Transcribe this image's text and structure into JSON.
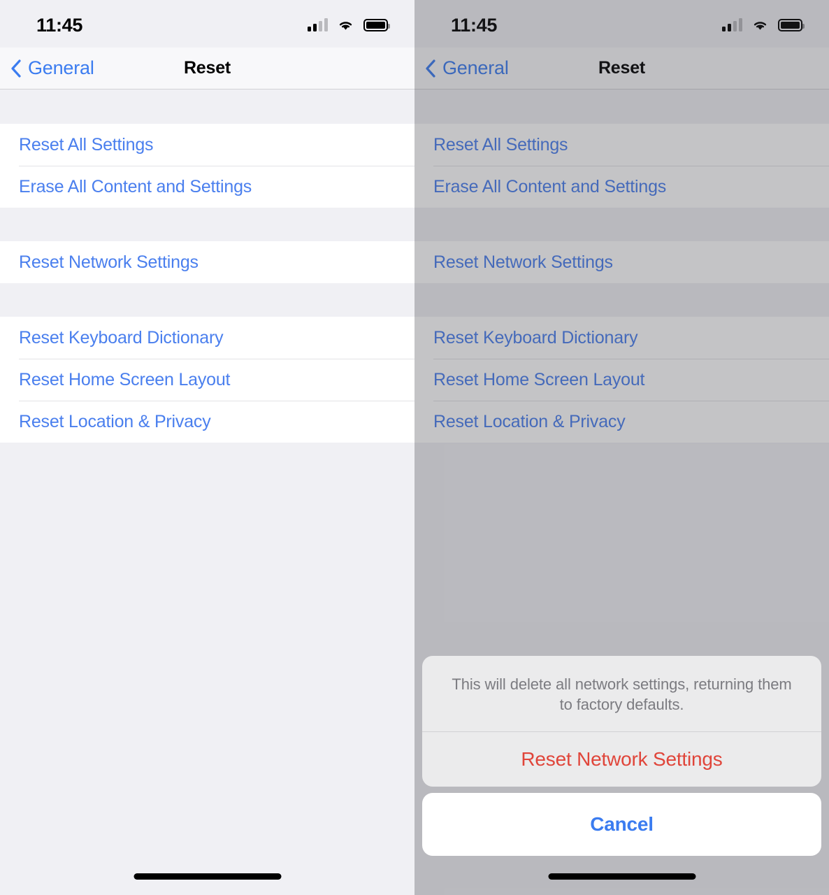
{
  "screens": [
    {
      "id": "reset-screen",
      "dimmed": false,
      "statusbar": {
        "time": "11:45",
        "cellular_icon": "cellular-bars-icon",
        "wifi_icon": "wifi-icon",
        "battery_icon": "battery-icon"
      },
      "navbar": {
        "back_icon": "chevron-left-icon",
        "back_label": "General",
        "title": "Reset"
      },
      "groups": [
        {
          "rows": [
            {
              "label": "Reset All Settings"
            },
            {
              "label": "Erase All Content and Settings"
            }
          ]
        },
        {
          "rows": [
            {
              "label": "Reset Network Settings"
            }
          ]
        },
        {
          "rows": [
            {
              "label": "Reset Keyboard Dictionary"
            },
            {
              "label": "Reset Home Screen Layout"
            },
            {
              "label": "Reset Location & Privacy"
            }
          ]
        }
      ],
      "home_indicator": "home-indicator"
    },
    {
      "id": "reset-screen-with-alert",
      "dimmed": true,
      "statusbar": {
        "time": "11:45",
        "cellular_icon": "cellular-bars-icon",
        "wifi_icon": "wifi-icon",
        "battery_icon": "battery-icon"
      },
      "navbar": {
        "back_icon": "chevron-left-icon",
        "back_label": "General",
        "title": "Reset"
      },
      "groups": [
        {
          "rows": [
            {
              "label": "Reset All Settings"
            },
            {
              "label": "Erase All Content and Settings"
            }
          ]
        },
        {
          "rows": [
            {
              "label": "Reset Network Settings"
            }
          ]
        },
        {
          "rows": [
            {
              "label": "Reset Keyboard Dictionary"
            },
            {
              "label": "Reset Home Screen Layout"
            },
            {
              "label": "Reset Location & Privacy"
            }
          ]
        }
      ],
      "action_sheet": {
        "message": "This will delete all network settings, returning them to factory defaults.",
        "destructive_label": "Reset Network Settings",
        "cancel_label": "Cancel"
      },
      "home_indicator": "home-indicator"
    }
  ],
  "colors": {
    "tint_blue": "#4a7fee",
    "nav_blue": "#3b7cf0",
    "destructive_red": "#e0453a",
    "background": "#f0f0f4",
    "row_background": "#ffffff",
    "separator": "#e3e3e6",
    "message_gray": "#7b7b80",
    "dim_overlay": "rgba(60,60,67,0.30)"
  }
}
